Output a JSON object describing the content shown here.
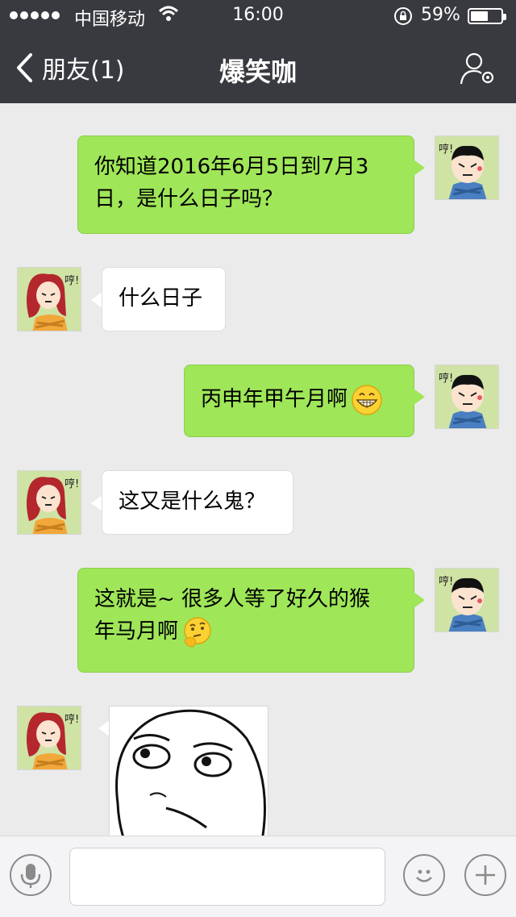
{
  "status_bar": {
    "carrier": "中国移动",
    "time": "16:00",
    "battery_percent": "59%",
    "battery_level": 0.59
  },
  "nav": {
    "back_label": "朋友(1)",
    "title": "爆笑咖"
  },
  "messages": [
    {
      "sender": "me",
      "text_line1": "你知道2016年6月5日到7月3",
      "text_line2": "日，是什么日子吗？"
    },
    {
      "sender": "friend",
      "text": "什么日子"
    },
    {
      "sender": "me",
      "text": "丙申年甲午月啊",
      "emoji": "grinning-face"
    },
    {
      "sender": "friend",
      "text": "这又是什么鬼？"
    },
    {
      "sender": "me",
      "text_line1": "这就是~ 很多人等了好久的猴",
      "text_line2": "年马月啊",
      "emoji": "thinking-face"
    },
    {
      "sender": "friend",
      "type": "sticker",
      "sticker": "rage-comic-face"
    }
  ],
  "avatar_caption": "哼!",
  "input_bar": {
    "voice_icon": "microphone-icon",
    "emoji_icon": "smiley-icon",
    "plus_icon": "plus-icon",
    "text_value": ""
  },
  "colors": {
    "nav_background": "#393a3f",
    "chat_background": "#ebebeb",
    "my_bubble": "#9fe658",
    "friend_bubble": "#ffffff"
  }
}
